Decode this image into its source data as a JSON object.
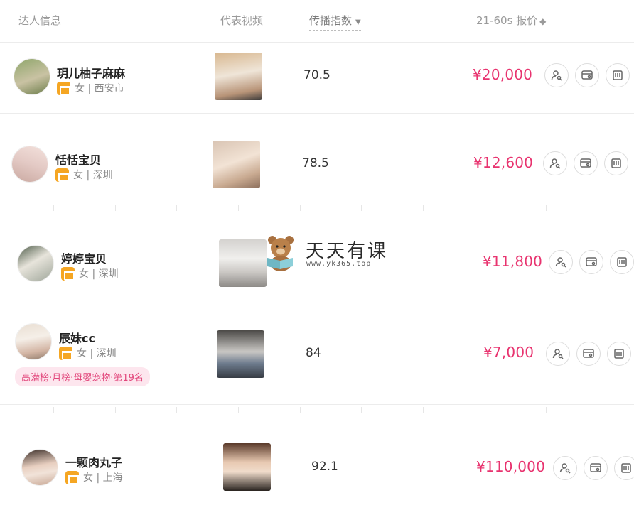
{
  "header": {
    "kol_info": "达人信息",
    "video": "代表视频",
    "spread_index": "传播指数",
    "price": "21-60s 报价"
  },
  "rows": [
    {
      "name": "玥儿柚子麻麻",
      "gender_city": "女 | 西安市",
      "score": "70.5",
      "price": "¥20,000",
      "rank": ""
    },
    {
      "name": "恬恬宝贝",
      "gender_city": "女 | 深圳",
      "score": "78.5",
      "price": "¥12,600",
      "rank": ""
    },
    {
      "name": "婷婷宝贝",
      "gender_city": "女 | 深圳",
      "score": "",
      "price": "¥11,800",
      "rank": ""
    },
    {
      "name": "辰妹cc",
      "gender_city": "女 | 深圳",
      "score": "84",
      "price": "¥7,000",
      "rank": "高潜榜·月榜·母婴宠物·第19名"
    },
    {
      "name": "一颗肉丸子",
      "gender_city": "女 | 上海",
      "score": "92.1",
      "price": "¥110,000",
      "rank": ""
    }
  ],
  "watermark": {
    "brand": "天天有课",
    "url": "www.yk365.top"
  },
  "colors": {
    "price": "#e8336f",
    "shop_badge": "#f5a623",
    "rank_bg": "#fde6ee"
  },
  "icons": {
    "action1": "user-search-icon",
    "action2": "card-view-icon",
    "action3": "calendar-icon"
  }
}
